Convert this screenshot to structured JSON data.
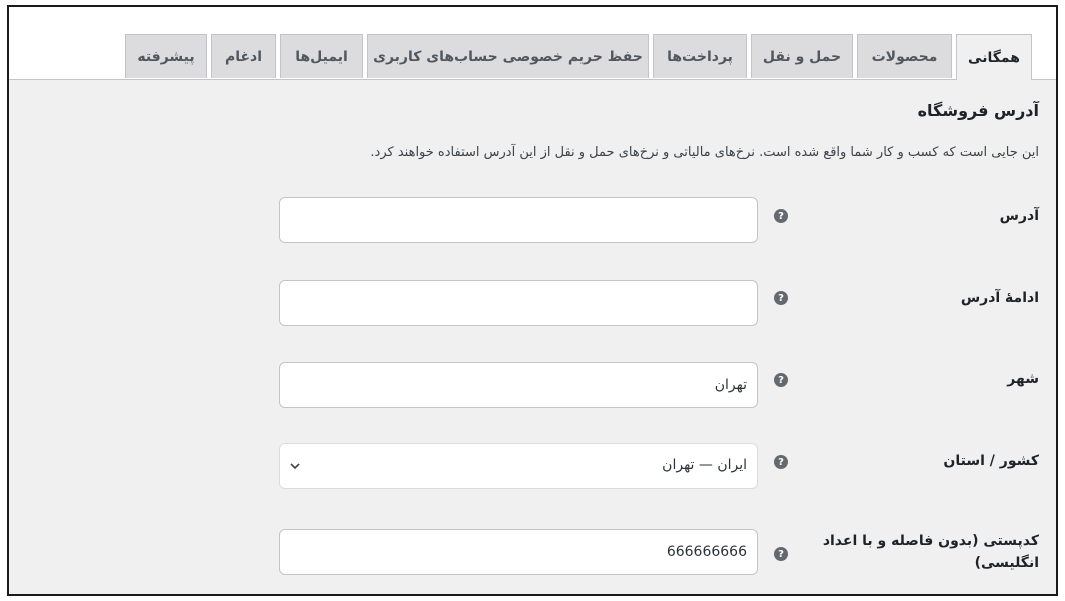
{
  "tabs": [
    {
      "label": "همگانی",
      "active": true
    },
    {
      "label": "محصولات",
      "active": false
    },
    {
      "label": "حمل و نقل",
      "active": false
    },
    {
      "label": "پرداخت‌ها",
      "active": false
    },
    {
      "label": "حفظ حریم خصوصی حساب‌های کاربری",
      "active": false
    },
    {
      "label": "ایمیل‌ها",
      "active": false
    },
    {
      "label": "ادغام",
      "active": false
    },
    {
      "label": "پیشرفته",
      "active": false
    }
  ],
  "section": {
    "title": "آدرس فروشگاه",
    "description": "این جایی است که کسب و کار شما واقع شده است. نرخ‌های مالیاتی و نرخ‌های حمل و نقل از این آدرس استفاده خواهند کرد."
  },
  "fields": {
    "address": {
      "label": "آدرس",
      "value": ""
    },
    "address2": {
      "label": "ادامهٔ آدرس",
      "value": ""
    },
    "city": {
      "label": "شهر",
      "value": "تهران"
    },
    "country": {
      "label": "کشور / استان",
      "value": "ایران — تهران"
    },
    "postcode": {
      "label_line1": "کدپستی (بدون فاصله و با اعداد",
      "label_line2": "انگلیسی)",
      "value": "666666666"
    }
  },
  "help_icon_glyph": "?",
  "icons": {
    "help": "question-circle-icon",
    "dropdown": "chevron-down-icon"
  },
  "colors": {
    "tab_bg": "#dcdcde",
    "panel_bg": "#f0f0f1",
    "help_icon": "#646970"
  }
}
